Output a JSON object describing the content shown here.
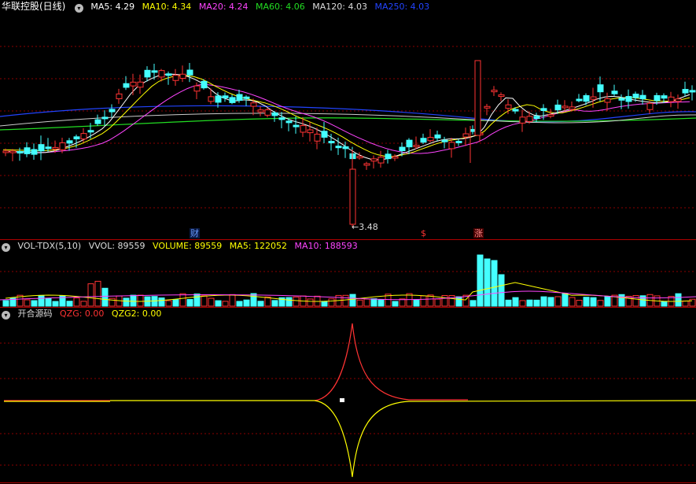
{
  "main": {
    "title": "华联控股(日线)",
    "mas": [
      {
        "label": "MA5: 4.29",
        "color": "#ffffff"
      },
      {
        "label": "MA10: 4.34",
        "color": "#ffff00"
      },
      {
        "label": "MA20: 4.24",
        "color": "#ff44ff"
      },
      {
        "label": "MA60: 4.06",
        "color": "#22dd22"
      },
      {
        "label": "MA120: 4.03",
        "color": "#dddddd"
      },
      {
        "label": "MA250: 4.03",
        "color": "#2244ff"
      }
    ],
    "low_label": "3.48",
    "badges": [
      {
        "text": "财",
        "color": "#6699ff",
        "bg": "#0a1a44"
      },
      {
        "text": "$",
        "color": "#ff3333",
        "bg": "#000000"
      },
      {
        "text": "涨",
        "color": "#ff8888",
        "bg": "#440000"
      }
    ]
  },
  "volume": {
    "title": "VOL-TDX(5,10)",
    "items": [
      {
        "label": "VVOL: 89559",
        "color": "#dddddd"
      },
      {
        "label": "VOLUME: 89559",
        "color": "#ffff00"
      },
      {
        "label": "MA5: 122052",
        "color": "#ffff00"
      },
      {
        "label": "MA10: 188593",
        "color": "#ff44ff"
      }
    ]
  },
  "indicator": {
    "title": "开合源码",
    "items": [
      {
        "label": "QZG: 0.00",
        "color": "#ff3333"
      },
      {
        "label": "QZG2: 0.00",
        "color": "#ffff00"
      }
    ]
  },
  "colors": {
    "up": "#ff3333",
    "down": "#44ffff",
    "grid": "#8b0000",
    "bg": "#000000"
  }
}
